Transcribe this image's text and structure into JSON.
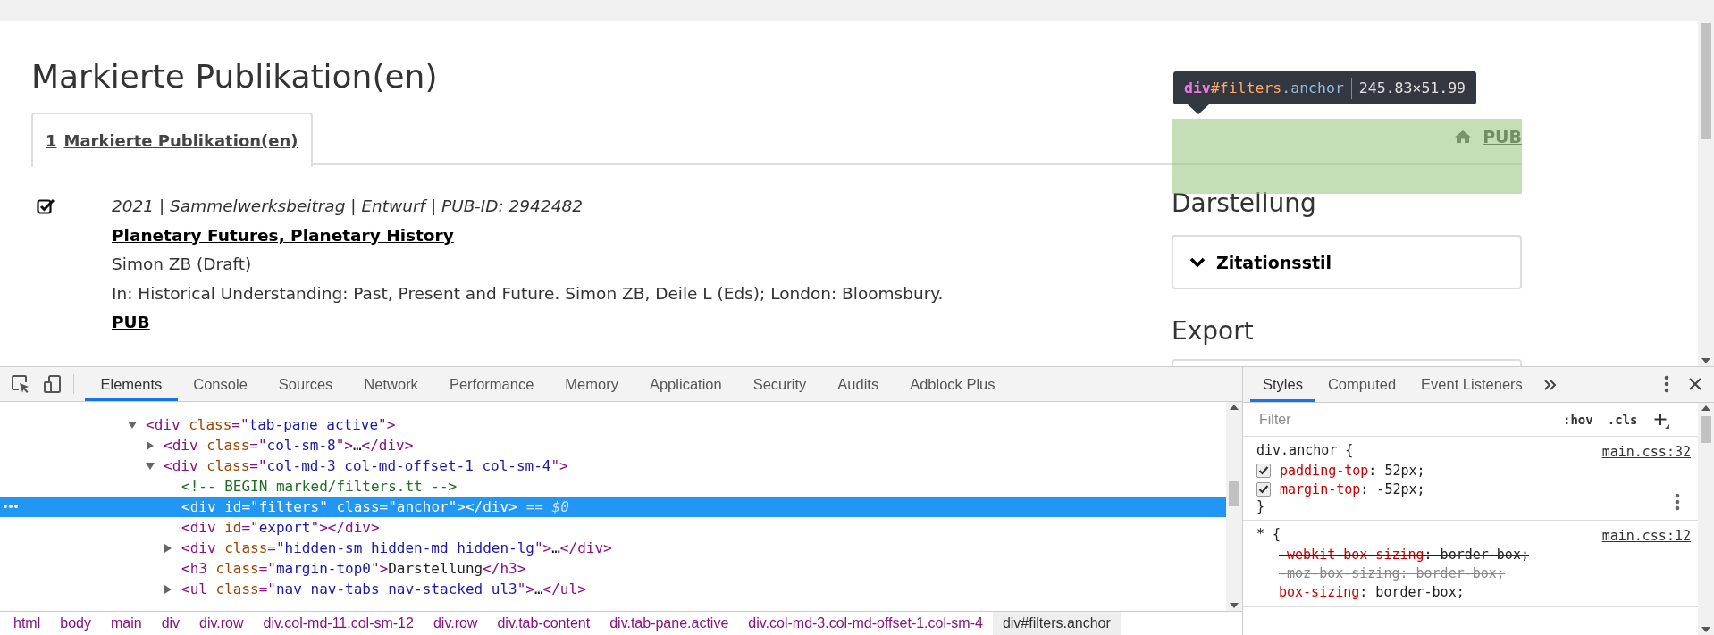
{
  "page": {
    "heading": "Markierte Publikation(en)",
    "tabs": [
      {
        "count": "1",
        "label": "Markierte Publikation(en)",
        "selected": true
      }
    ],
    "publications": [
      {
        "checked": true,
        "meta": "2021 | Sammelwerksbeitrag | Entwurf | PUB-ID: 2942482",
        "title": "Planetary Futures, Planetary History",
        "authors": "Simon ZB (Draft)",
        "source": "In: Historical Understanding: Past, Present and Future. Simon ZB, Deile L (Eds); London: Bloomsbury.",
        "link": "PUB"
      }
    ],
    "sidebar": {
      "home_link": "PUB",
      "sections": [
        {
          "heading": "Darstellung",
          "panel": "Zitationsstil"
        },
        {
          "heading": "Export"
        }
      ]
    },
    "inspect_tooltip": {
      "tag": "div",
      "id": "#filters",
      "cls": ".anchor",
      "size": "245.83×51.99"
    }
  },
  "devtools": {
    "tabs": [
      {
        "label": "Elements",
        "selected": true
      },
      {
        "label": "Console",
        "selected": false
      },
      {
        "label": "Sources",
        "selected": false
      },
      {
        "label": "Network",
        "selected": false
      },
      {
        "label": "Performance",
        "selected": false
      },
      {
        "label": "Memory",
        "selected": false
      },
      {
        "label": "Application",
        "selected": false
      },
      {
        "label": "Security",
        "selected": false
      },
      {
        "label": "Audits",
        "selected": false
      },
      {
        "label": "Adblock Plus",
        "selected": false
      }
    ],
    "tree": [
      {
        "selected": false,
        "expanded": true,
        "tokens": [
          {
            "text": "<div",
            "kind": "tag"
          },
          {
            "text": " class",
            "kind": "attr"
          },
          {
            "text": "=\"",
            "kind": "tag"
          },
          {
            "text": "tab-pane active",
            "kind": "val"
          },
          {
            "text": "\">",
            "kind": "tag"
          }
        ],
        "children": [
          {
            "selected": false,
            "expanded": false,
            "tokens": [
              {
                "text": "<div",
                "kind": "tag"
              },
              {
                "text": " class",
                "kind": "attr"
              },
              {
                "text": "=\"",
                "kind": "tag"
              },
              {
                "text": "col-sm-8",
                "kind": "val"
              },
              {
                "text": "\">",
                "kind": "tag"
              },
              {
                "text": "…",
                "kind": "text"
              },
              {
                "text": "</div>",
                "kind": "tag"
              }
            ]
          },
          {
            "selected": false,
            "expanded": true,
            "tokens": [
              {
                "text": "<div",
                "kind": "tag"
              },
              {
                "text": " class",
                "kind": "attr"
              },
              {
                "text": "=\"",
                "kind": "tag"
              },
              {
                "text": "col-md-3 col-md-offset-1 col-sm-4",
                "kind": "val"
              },
              {
                "text": "\">",
                "kind": "tag"
              }
            ],
            "children": [
              {
                "selected": false,
                "tokens": [
                  {
                    "text": "<!-- BEGIN marked/filters.tt -->",
                    "kind": "comment"
                  }
                ]
              },
              {
                "selected": true,
                "tokens": [
                  {
                    "text": "<div",
                    "kind": "tag"
                  },
                  {
                    "text": " id",
                    "kind": "attr"
                  },
                  {
                    "text": "=\"",
                    "kind": "tag"
                  },
                  {
                    "text": "filters",
                    "kind": "val"
                  },
                  {
                    "text": "\"",
                    "kind": "tag"
                  },
                  {
                    "text": " class",
                    "kind": "attr"
                  },
                  {
                    "text": "=\"",
                    "kind": "tag"
                  },
                  {
                    "text": "anchor",
                    "kind": "val"
                  },
                  {
                    "text": "\"></div>",
                    "kind": "tag"
                  }
                ],
                "console_ref": "== $0"
              },
              {
                "selected": false,
                "tokens": [
                  {
                    "text": "<div",
                    "kind": "tag"
                  },
                  {
                    "text": " id",
                    "kind": "attr"
                  },
                  {
                    "text": "=\"",
                    "kind": "tag"
                  },
                  {
                    "text": "export",
                    "kind": "val"
                  },
                  {
                    "text": "\"></div>",
                    "kind": "tag"
                  }
                ]
              },
              {
                "selected": false,
                "expanded": false,
                "tokens": [
                  {
                    "text": "<div",
                    "kind": "tag"
                  },
                  {
                    "text": " class",
                    "kind": "attr"
                  },
                  {
                    "text": "=\"",
                    "kind": "tag"
                  },
                  {
                    "text": "hidden-sm hidden-md hidden-lg",
                    "kind": "val"
                  },
                  {
                    "text": "\">",
                    "kind": "tag"
                  },
                  {
                    "text": "…",
                    "kind": "text"
                  },
                  {
                    "text": "</div>",
                    "kind": "tag"
                  }
                ]
              },
              {
                "selected": false,
                "tokens": [
                  {
                    "text": "<h3",
                    "kind": "tag"
                  },
                  {
                    "text": " class",
                    "kind": "attr"
                  },
                  {
                    "text": "=\"",
                    "kind": "tag"
                  },
                  {
                    "text": "margin-top0",
                    "kind": "val"
                  },
                  {
                    "text": "\">",
                    "kind": "tag"
                  },
                  {
                    "text": "Darstellung",
                    "kind": "text"
                  },
                  {
                    "text": "</h3>",
                    "kind": "tag"
                  }
                ]
              },
              {
                "selected": false,
                "expanded": false,
                "tokens": [
                  {
                    "text": "<ul",
                    "kind": "tag"
                  },
                  {
                    "text": " class",
                    "kind": "attr"
                  },
                  {
                    "text": "=\"",
                    "kind": "tag"
                  },
                  {
                    "text": "nav nav-tabs nav-stacked ul3",
                    "kind": "val"
                  },
                  {
                    "text": "\">",
                    "kind": "tag"
                  },
                  {
                    "text": "…",
                    "kind": "text"
                  },
                  {
                    "text": "</ul>",
                    "kind": "tag"
                  }
                ]
              }
            ]
          }
        ]
      }
    ],
    "breadcrumbs": [
      {
        "label": "html",
        "selected": false
      },
      {
        "label": "body",
        "selected": false
      },
      {
        "label": "main",
        "selected": false
      },
      {
        "label": "div",
        "selected": false
      },
      {
        "label": "div.row",
        "selected": false
      },
      {
        "label": "div.col-md-11.col-sm-12",
        "selected": false
      },
      {
        "label": "div.row",
        "selected": false
      },
      {
        "label": "div.tab-content",
        "selected": false
      },
      {
        "label": "div.tab-pane.active",
        "selected": false
      },
      {
        "label": "div.col-md-3.col-md-offset-1.col-sm-4",
        "selected": false
      },
      {
        "label": "div#filters.anchor",
        "selected": true
      }
    ],
    "side_tabs": [
      {
        "label": "Styles",
        "selected": true
      },
      {
        "label": "Computed",
        "selected": false
      },
      {
        "label": "Event Listeners",
        "selected": false
      }
    ],
    "filter": {
      "placeholder": "Filter",
      "hov": ":hov",
      "cls": ".cls"
    },
    "rules": [
      {
        "selector": "div.anchor {",
        "source": "main.css:32",
        "close": "}",
        "props": [
          {
            "name": "padding-top",
            "value": ": 52px;",
            "checked": true,
            "kind": "active"
          },
          {
            "name": "margin-top",
            "value": ": -52px;",
            "checked": true,
            "kind": "active"
          }
        ]
      },
      {
        "selector": "* {",
        "source": "main.css:12",
        "props": [
          {
            "name": "-webkit-box-sizing",
            "value": ": border-box;",
            "kind": "overridden"
          },
          {
            "name": "-moz-box-sizing",
            "value": ": border-box;",
            "kind": "invalid"
          },
          {
            "name": "box-sizing",
            "value": ": border-box;",
            "kind": "active"
          }
        ]
      }
    ]
  }
}
